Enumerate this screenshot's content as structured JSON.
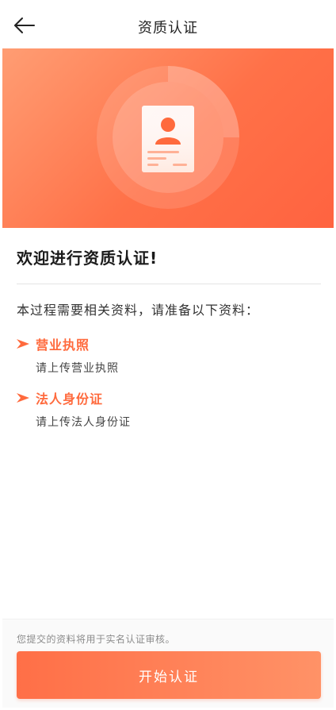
{
  "header": {
    "title": "资质认证",
    "back_icon": "back-arrow-icon"
  },
  "banner": {
    "illustration": "id-card-icon",
    "gradient_start": "#ff9d73",
    "gradient_end": "#ff6340"
  },
  "main": {
    "welcome_title": "欢迎进行资质认证!",
    "intro": "本过程需要相关资料，请准备以下资料：",
    "requirements": [
      {
        "title": "营业执照",
        "desc": "请上传营业执照",
        "icon": "arrow-right-icon"
      },
      {
        "title": "法人身份证",
        "desc": "请上传法人身份证",
        "icon": "arrow-right-icon"
      }
    ]
  },
  "footer": {
    "notice": "您提交的资料将用于实名认证审核。",
    "start_label": "开始认证"
  },
  "colors": {
    "accent": "#ff6a3d",
    "button_start": "#ff6f47",
    "button_end": "#ff9267"
  }
}
